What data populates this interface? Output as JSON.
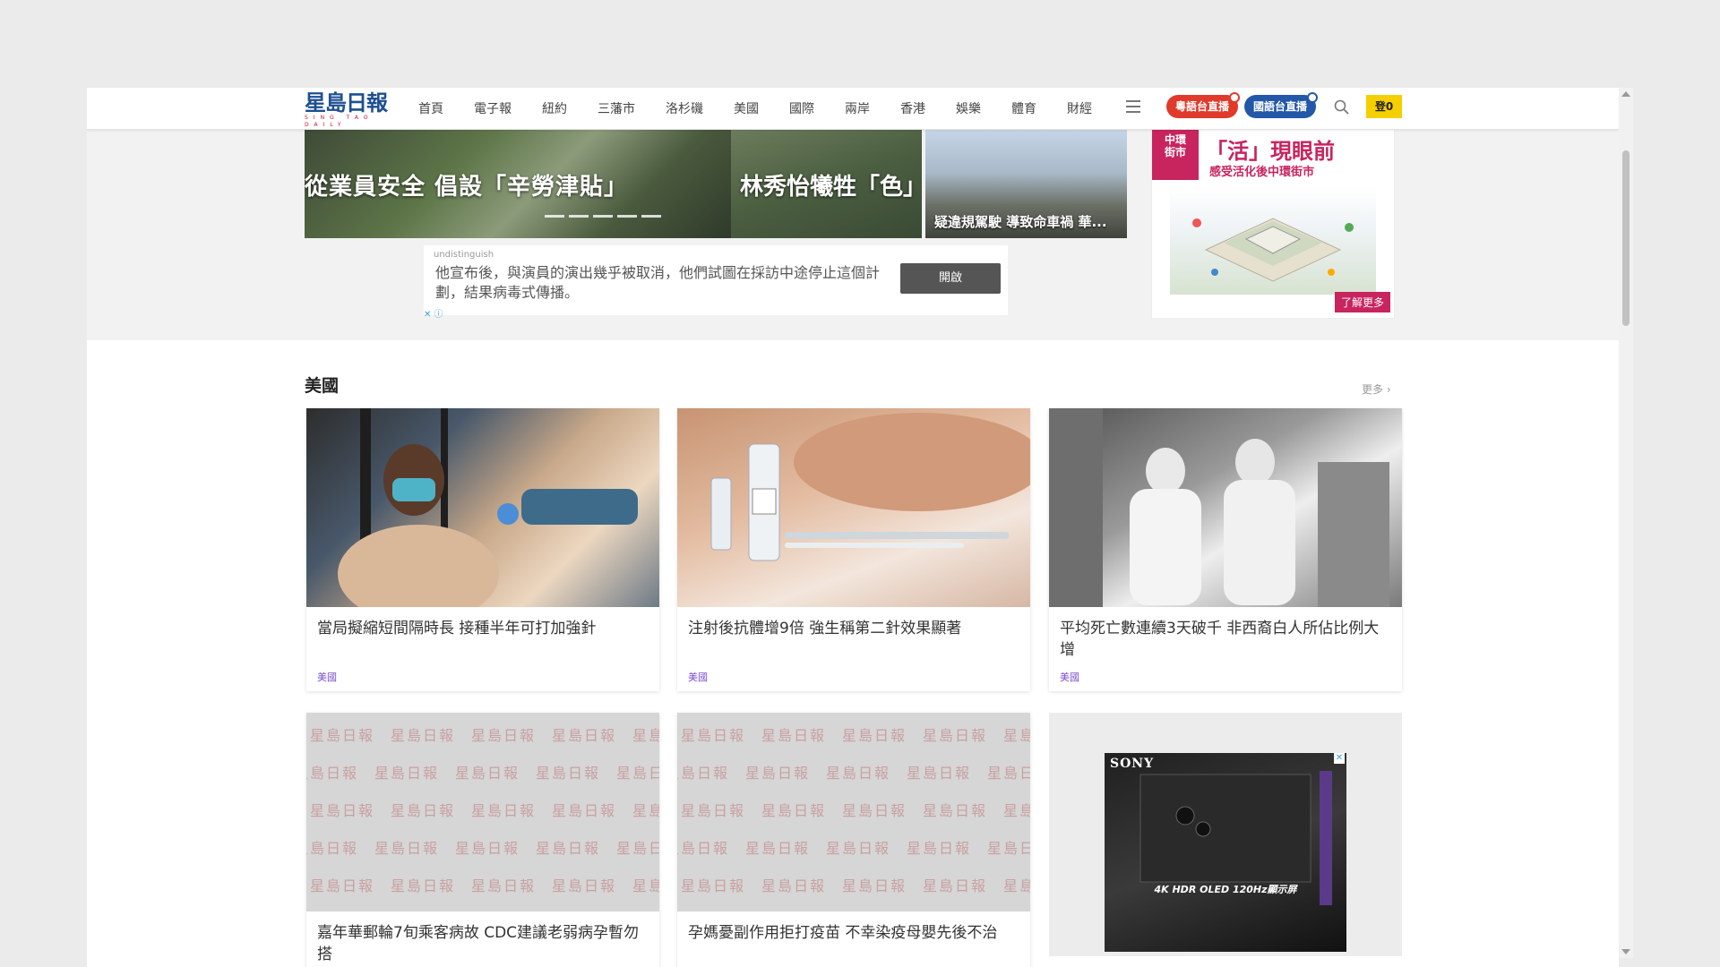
{
  "logo": {
    "text": "星島日報",
    "sub": "SING TAO DAILY"
  },
  "nav": {
    "items": [
      "首頁",
      "電子報",
      "紐約",
      "三藩市",
      "洛杉磯",
      "美國",
      "國際",
      "兩岸",
      "香港",
      "娛樂",
      "體育",
      "財經"
    ]
  },
  "header": {
    "live_cantonese": "粵語台直播",
    "live_mandarin": "國語台直播",
    "login": "登0"
  },
  "hero": {
    "slide_title": "從業員安全 倡設「辛勞津貼」",
    "slide2_title": "林秀怡犧牲「色」",
    "thumb3_title": "疑違規駕駛 導致命車禍 華..."
  },
  "ad_text": {
    "source": "undistinguish",
    "copy": "他宣布後，與演員的演出幾乎被取消，他們試圖在採訪中途停止這個計劃，結果病毒式傳播。",
    "button": "開啟",
    "choices": "✕ ⓘ"
  },
  "side_ad": {
    "logo": "中環\n街市",
    "title": "「活」現眼前",
    "subtitle": "感受活化後中環街市",
    "cta": "了解更多"
  },
  "section": {
    "title": "美國",
    "more": "更多 ›"
  },
  "cards": [
    {
      "title": "當局擬縮短間隔時長 接種半年可打加強針",
      "tag": "美國"
    },
    {
      "title": "注射後抗體增9倍 強生稱第二針效果顯著",
      "tag": "美國"
    },
    {
      "title": "平均死亡數連續3天破千 非西裔白人所佔比例大增",
      "tag": "美國"
    },
    {
      "title": "嘉年華郵輪7旬乘客病故 CDC建議老弱病孕暫勿搭",
      "tag": ""
    },
    {
      "title": "孕媽憂副作用拒打疫苗 不幸染疫母嬰先後不治",
      "tag": ""
    }
  ],
  "placeholder_text": "星島日報　星島日報　星島日報　星島日報　星島日報",
  "sony_ad": {
    "brand": "SONY",
    "caption": "4K HDR OLED 120Hz顯示屏",
    "close": "✕"
  }
}
